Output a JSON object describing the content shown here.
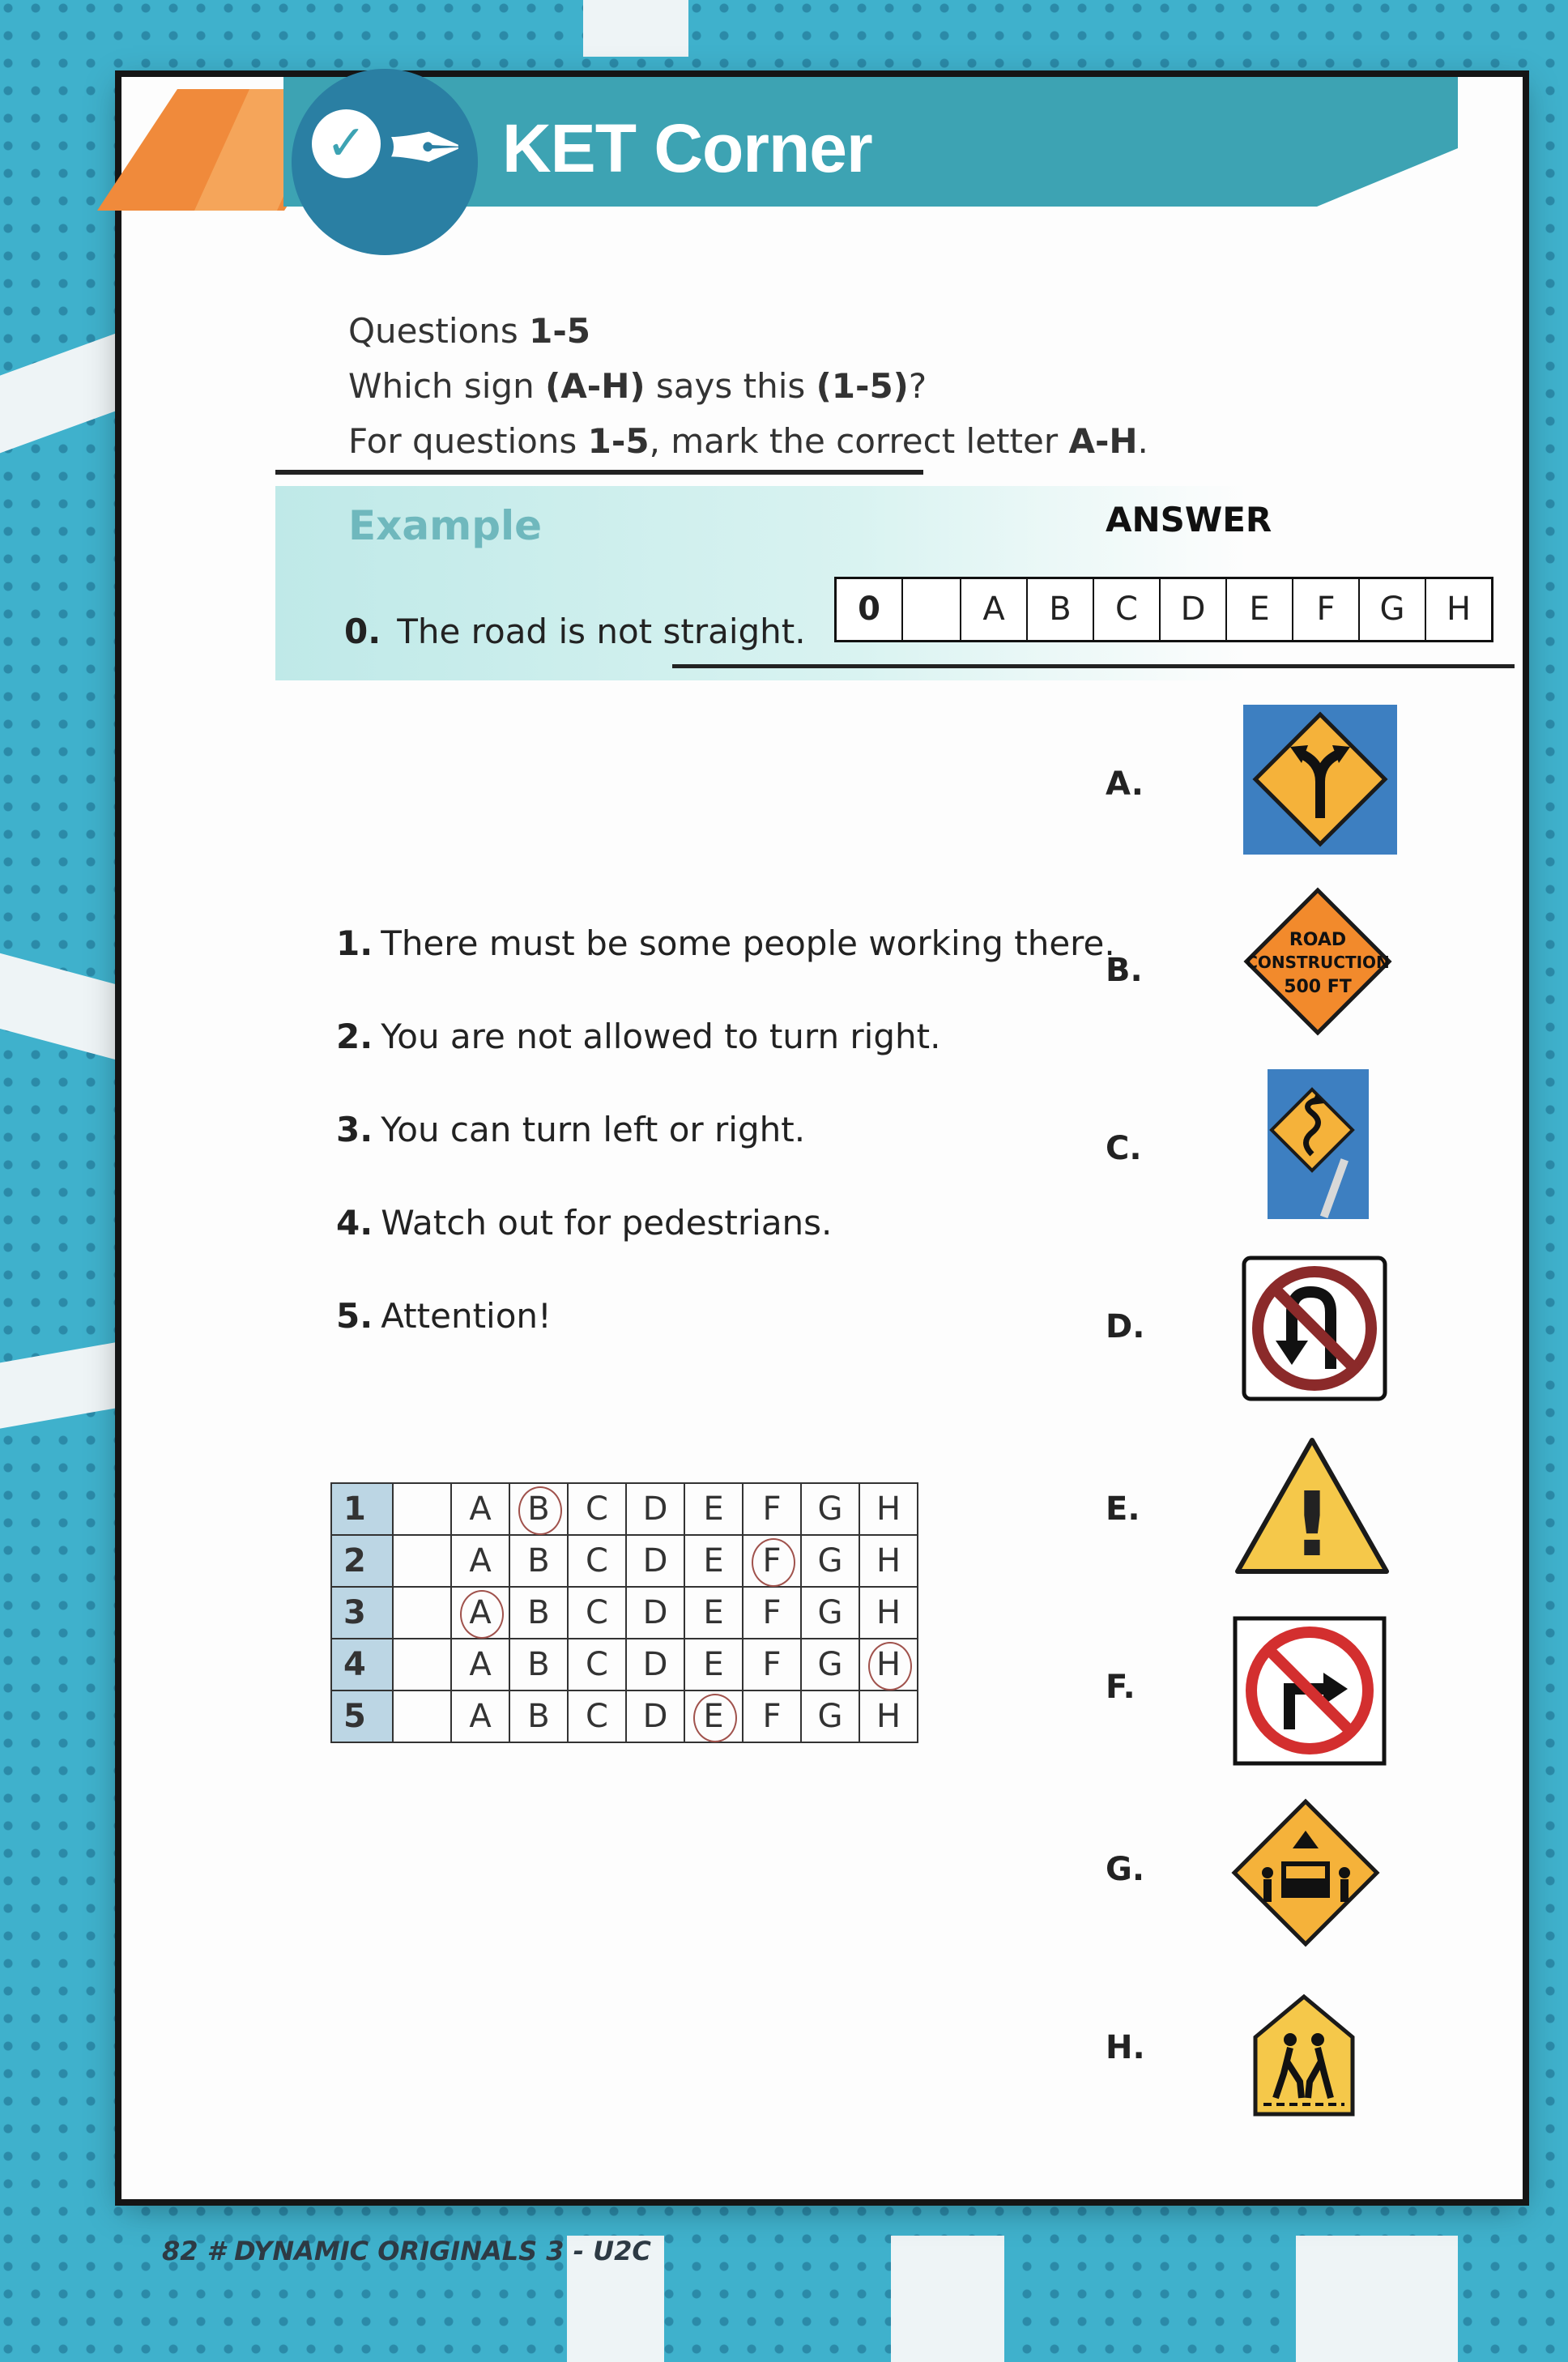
{
  "banner": {
    "title": "KET Corner"
  },
  "instructions": {
    "line1_a": "Questions ",
    "line1_b": "1-5",
    "line2_a": "Which sign ",
    "line2_b": "(A-H)",
    "line2_c": " says this ",
    "line2_d": "(1-5)",
    "line2_e": "?",
    "line3_a": "For questions ",
    "line3_b": "1-5",
    "line3_c": ", mark the correct letter ",
    "line3_d": "A-H",
    "line3_e": "."
  },
  "example": {
    "title": "Example",
    "answer_label": "ANSWER",
    "number": "0.",
    "text": "The road is not straight.",
    "answer_row": {
      "num": "0",
      "letters": [
        "A",
        "B",
        "C",
        "D",
        "E",
        "F",
        "G",
        "H"
      ],
      "selected": "C"
    }
  },
  "questions": [
    {
      "num": "1.",
      "text": "There must be some people working there."
    },
    {
      "num": "2.",
      "text": "You are not allowed to turn right."
    },
    {
      "num": "3.",
      "text": "You can turn left or right."
    },
    {
      "num": "4.",
      "text": "Watch out for pedestrians."
    },
    {
      "num": "5.",
      "text": "Attention!"
    }
  ],
  "answer_grid": {
    "letters": [
      "A",
      "B",
      "C",
      "D",
      "E",
      "F",
      "G",
      "H"
    ],
    "rows": [
      {
        "num": "1",
        "selected": "B"
      },
      {
        "num": "2",
        "selected": "F"
      },
      {
        "num": "3",
        "selected": "A"
      },
      {
        "num": "4",
        "selected": "H"
      },
      {
        "num": "5",
        "selected": "E"
      }
    ]
  },
  "signs": [
    {
      "letter": "A.",
      "icon": "fork-road-sign-icon"
    },
    {
      "letter": "B.",
      "icon": "road-construction-sign-icon",
      "line1": "ROAD",
      "line2": "CONSTRUCTION",
      "line3": "500 FT"
    },
    {
      "letter": "C.",
      "icon": "winding-road-sign-icon"
    },
    {
      "letter": "D.",
      "icon": "no-u-turn-sign-icon"
    },
    {
      "letter": "E.",
      "icon": "warning-sign-icon",
      "symbol": "!"
    },
    {
      "letter": "F.",
      "icon": "no-right-turn-sign-icon"
    },
    {
      "letter": "G.",
      "icon": "school-bus-stop-sign-icon"
    },
    {
      "letter": "H.",
      "icon": "school-crossing-sign-icon"
    }
  ],
  "footer": {
    "page_number": "82",
    "book": "DYNAMIC ORIGINALS 3 - U2C"
  },
  "colors": {
    "banner": "#3da3b3",
    "accent_orange": "#f08a3b",
    "sign_yellow": "#f5b23a",
    "sign_orange": "#f28a2c",
    "prohibit_red": "#c62828"
  }
}
